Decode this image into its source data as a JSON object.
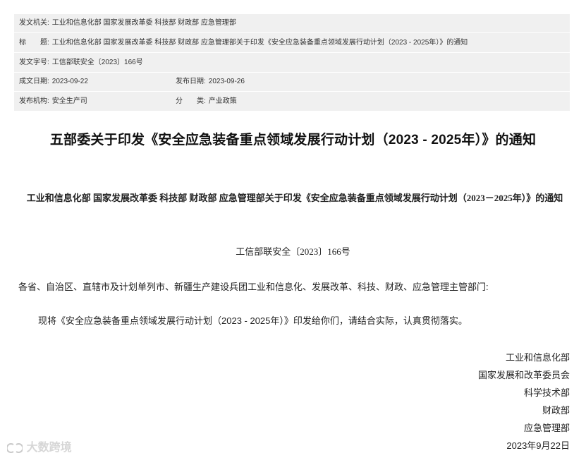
{
  "meta": {
    "issuer_label": "发文机关:",
    "issuer": "工业和信息化部 国家发展改革委 科技部 财政部 应急管理部",
    "title_label": "标　　题:",
    "title": "工业和信息化部 国家发展改革委 科技部 财政部 应急管理部关于印发《安全应急装备重点领域发展行动计划（2023 - 2025年）》的通知",
    "docno_label": "发文字号:",
    "docno": "工信部联安全〔2023〕166号",
    "created_label": "成文日期:",
    "created": "2023-09-22",
    "published_label": "发布日期:",
    "published": "2023-09-26",
    "org_label": "发布机构:",
    "org": "安全生产司",
    "category_label": "分　　类:",
    "category": "产业政策"
  },
  "article": {
    "title": "五部委关于印发《安全应急装备重点领域发展行动计划（2023 - 2025年）》的通知",
    "subtitle": "工业和信息化部 国家发展改革委 科技部 财政部 应急管理部关于印发《安全应急装备重点领域发展行动计划（2023－2025年）》的通知",
    "docno": "工信部联安全〔2023〕166号",
    "salutation": "各省、自治区、直辖市及计划单列市、新疆生产建设兵团工业和信息化、发展改革、科技、财政、应急管理主管部门:",
    "body": "现将《安全应急装备重点领域发展行动计划（2023 - 2025年）》印发给你们，请结合实际，认真贯彻落实。",
    "signers": [
      "工业和信息化部",
      "国家发展和改革委员会",
      "科学技术部",
      "财政部",
      "应急管理部"
    ],
    "date": "2023年9月22日"
  },
  "watermark": {
    "text": "大数跨境",
    "icon": "brand-logo-icon"
  }
}
